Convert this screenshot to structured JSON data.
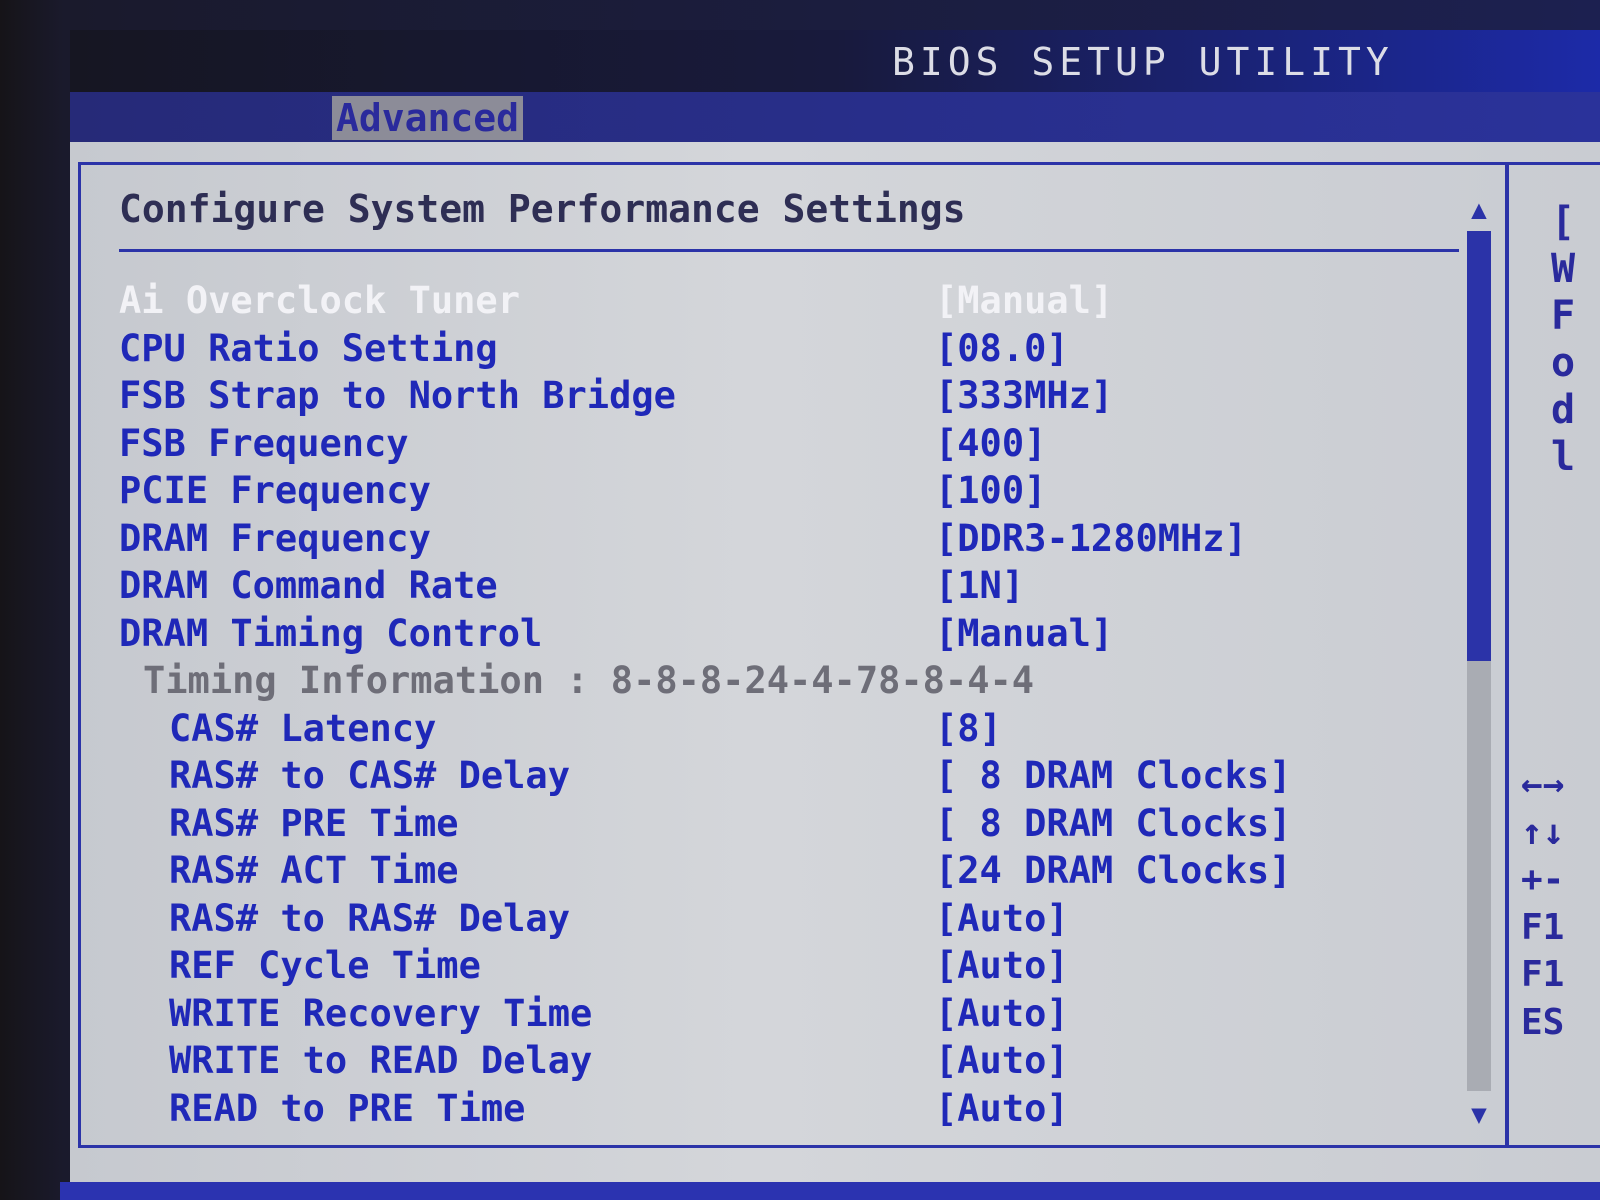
{
  "header": {
    "title": "BIOS SETUP UTILITY"
  },
  "menu": {
    "active_tab": "Advanced"
  },
  "panel": {
    "title": "Configure System Performance Settings",
    "rows": [
      {
        "label": "Ai Overclock Tuner",
        "value": "[Manual]",
        "kind": "selected"
      },
      {
        "label": "CPU Ratio Setting",
        "value": "[08.0]",
        "kind": "option"
      },
      {
        "label": "FSB Strap to North Bridge",
        "value": "[333MHz]",
        "kind": "option"
      },
      {
        "label": "FSB Frequency",
        "value": "[400]",
        "kind": "option"
      },
      {
        "label": "PCIE Frequency",
        "value": "[100]",
        "kind": "option"
      },
      {
        "label": "DRAM Frequency",
        "value": "[DDR3-1280MHz]",
        "kind": "option"
      },
      {
        "label": "DRAM Command Rate",
        "value": "[1N]",
        "kind": "option"
      },
      {
        "label": "DRAM Timing Control",
        "value": "[Manual]",
        "kind": "option"
      },
      {
        "label": "Timing Information : 8-8-8-24-4-78-8-4-4",
        "value": "",
        "kind": "info"
      },
      {
        "label": "CAS# Latency",
        "value": "[8]",
        "kind": "sub"
      },
      {
        "label": "RAS# to CAS# Delay",
        "value": "[ 8 DRAM Clocks]",
        "kind": "sub"
      },
      {
        "label": "RAS# PRE Time",
        "value": "[ 8 DRAM Clocks]",
        "kind": "sub"
      },
      {
        "label": "RAS# ACT Time",
        "value": "[24 DRAM Clocks]",
        "kind": "sub"
      },
      {
        "label": "RAS# to RAS# Delay",
        "value": "[Auto]",
        "kind": "sub"
      },
      {
        "label": "REF Cycle Time",
        "value": "[Auto]",
        "kind": "sub"
      },
      {
        "label": "WRITE Recovery Time",
        "value": "[Auto]",
        "kind": "sub"
      },
      {
        "label": "WRITE to READ Delay",
        "value": "[Auto]",
        "kind": "sub"
      },
      {
        "label": "READ to PRE Time",
        "value": "[Auto]",
        "kind": "sub"
      }
    ],
    "scroll_position_fraction": 0.5
  },
  "help": {
    "text_lines": [
      "[",
      "W",
      "F",
      "o",
      "d",
      "l"
    ],
    "keys": [
      "←→",
      "↑↓",
      "+-",
      "F1",
      "F1",
      "ES"
    ]
  },
  "icons": {
    "scroll_up": "scroll-up-arrow-icon",
    "scroll_down": "scroll-down-arrow-icon"
  },
  "colors": {
    "accent_blue": "#1f28b8",
    "selected_text": "#f2f2f6",
    "info_text": "#6e6e78"
  }
}
